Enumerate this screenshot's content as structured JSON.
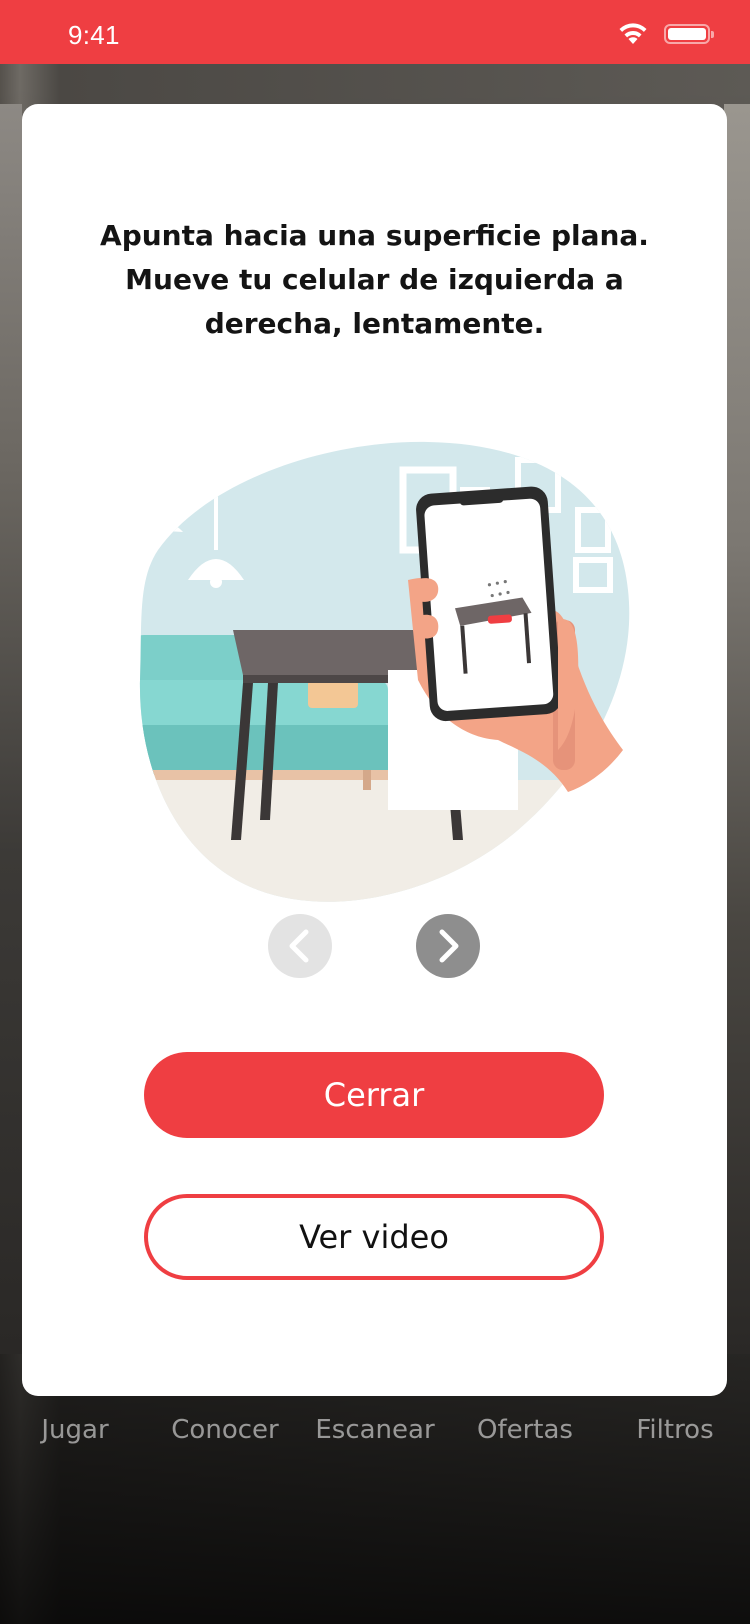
{
  "status_bar": {
    "time": "9:41",
    "color": "#ef3e42"
  },
  "bottom_nav": {
    "items": [
      "Jugar",
      "Conocer",
      "Escanear",
      "Ofertas",
      "Filtros"
    ]
  },
  "modal": {
    "instruction": "Apunta hacia una superficie plana.\nMueve tu celular de izquierda a\nderecha, lentamente.",
    "illustration_icon": "phone-scanning-table-illustration",
    "carousel": {
      "prev_icon": "chevron-left-icon",
      "next_icon": "chevron-right-icon"
    },
    "close_label": "Cerrar",
    "video_label": "Ver video"
  },
  "colors": {
    "accent": "#ef3e42",
    "disabled": "#e3e3e3",
    "enabled": "#8e8e8e"
  }
}
